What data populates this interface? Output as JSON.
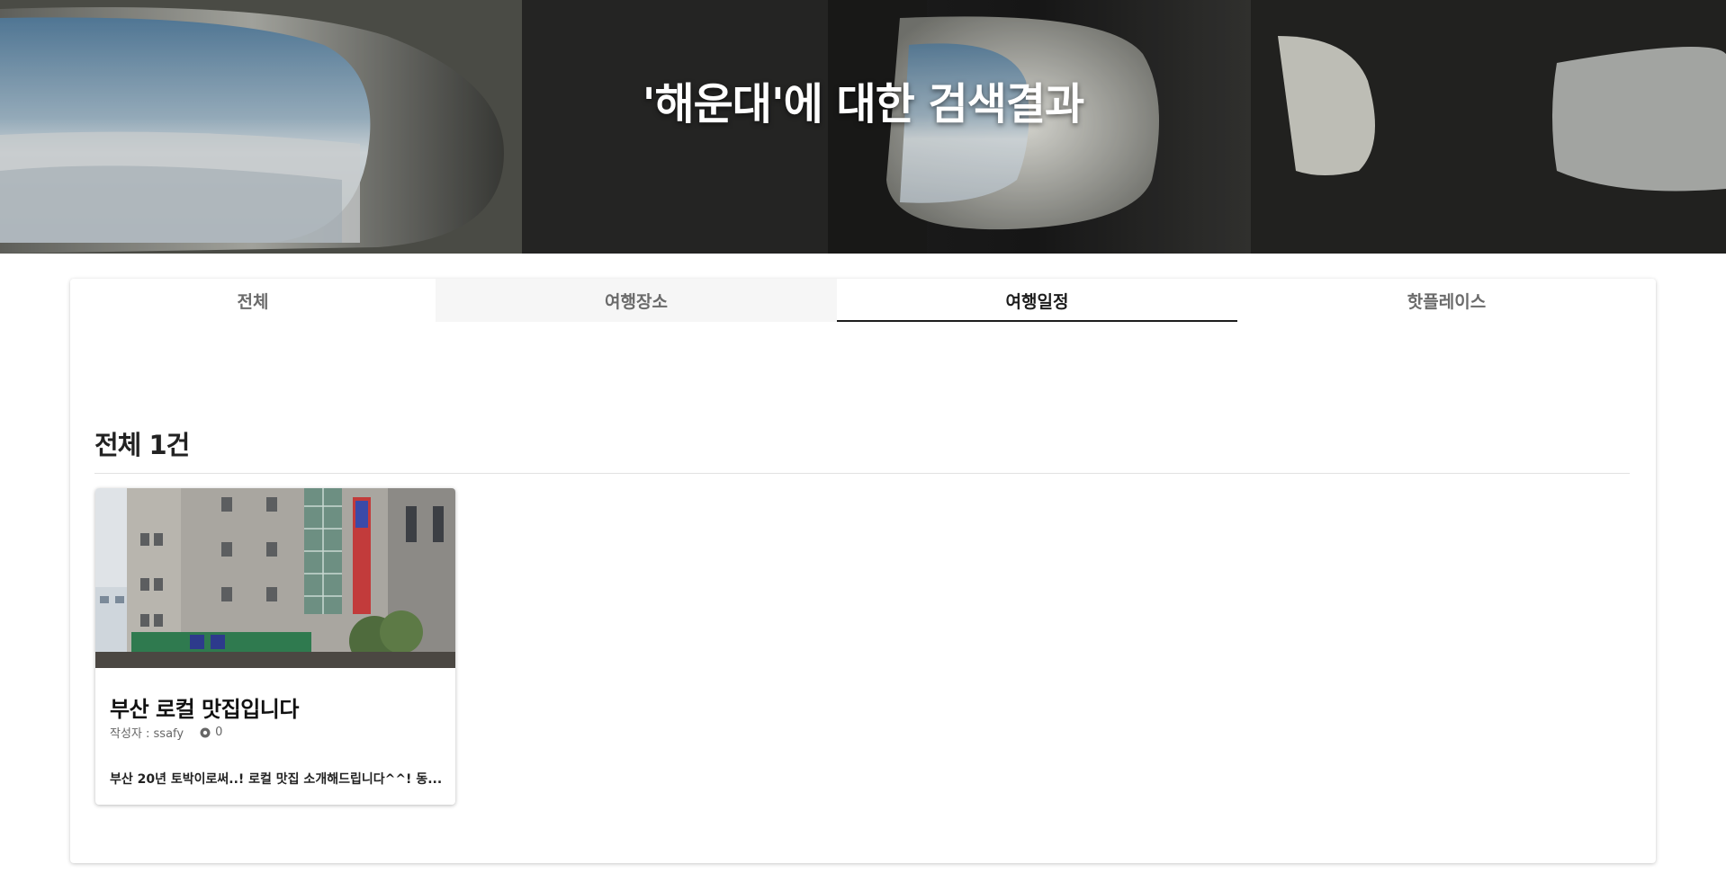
{
  "hero": {
    "title": "'해운대'에 대한 검색결과"
  },
  "tabs": [
    {
      "label": "전체",
      "state": "default"
    },
    {
      "label": "여행장소",
      "state": "hovered"
    },
    {
      "label": "여행일정",
      "state": "active"
    },
    {
      "label": "핫플레이스",
      "state": "default"
    }
  ],
  "results": {
    "count_label": "전체 1건",
    "cards": [
      {
        "title": "부산 로컬 맛집입니다",
        "author": "작성자 : ssafy",
        "views": "0",
        "views_icon": "eye-icon",
        "description": "부산 20년 토박이로써..! 로컬 맛집 소개해드립니다^^! 동..."
      }
    ]
  },
  "colors": {
    "active_tab_underline": "#1d1d1d",
    "tab_hover_bg": "#f6f6f6",
    "text_primary": "#111111",
    "text_muted": "#666666"
  }
}
